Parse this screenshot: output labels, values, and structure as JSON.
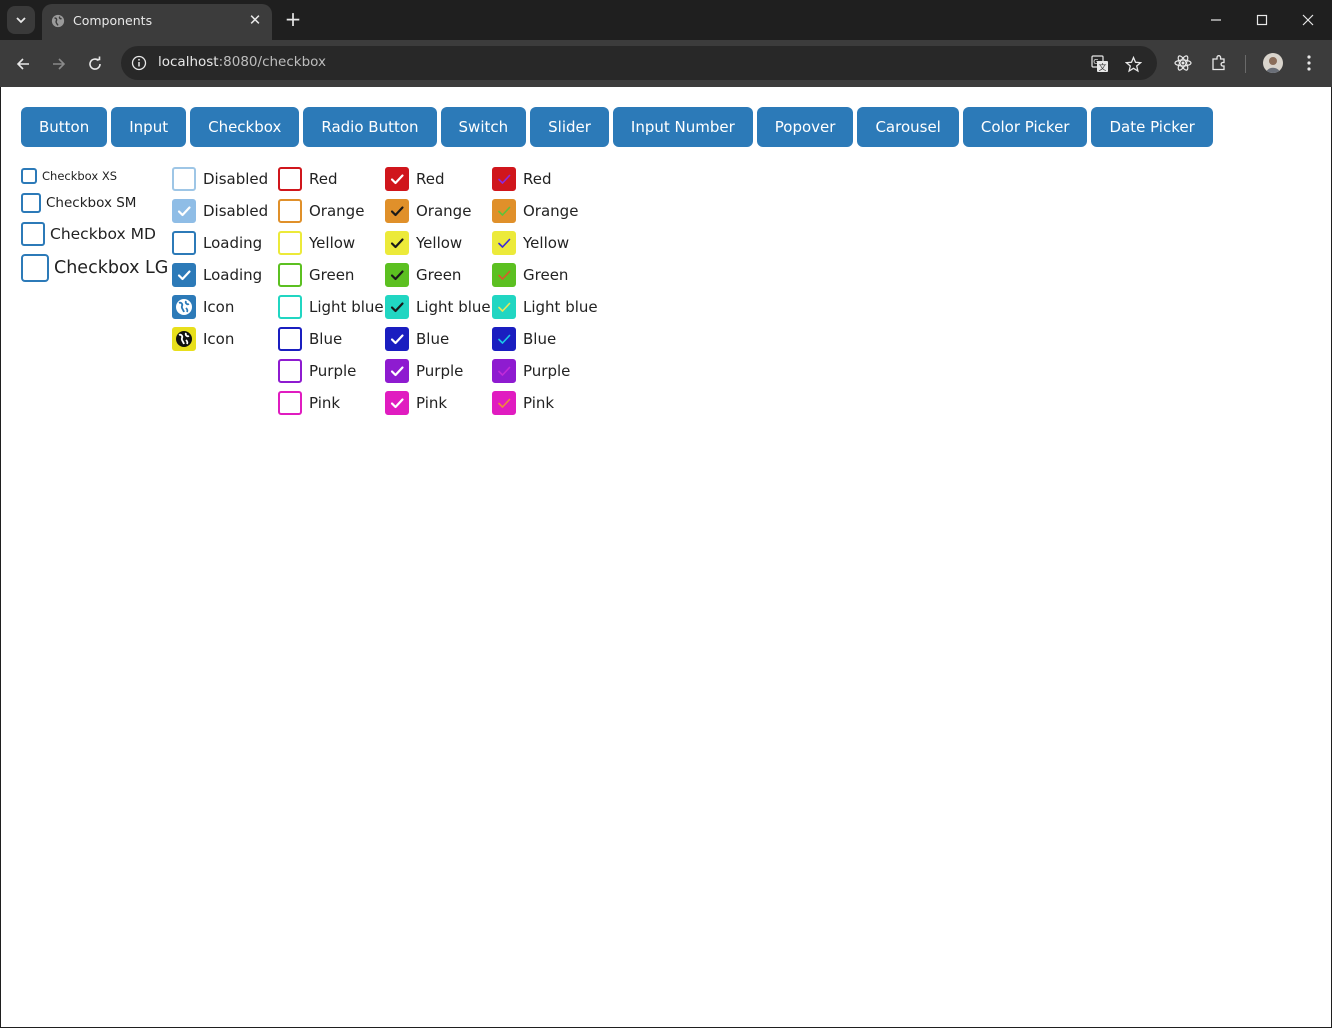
{
  "browser": {
    "tab_title": "Components",
    "url_host": "localhost",
    "url_path": ":8080/checkbox"
  },
  "nav": [
    "Button",
    "Input",
    "Checkbox",
    "Radio Button",
    "Switch",
    "Slider",
    "Input Number",
    "Popover",
    "Carousel",
    "Color Picker",
    "Date Picker"
  ],
  "sizes": [
    "Checkbox XS",
    "Checkbox SM",
    "Checkbox MD",
    "Checkbox LG"
  ],
  "states": [
    {
      "label": "Disabled",
      "state": "disabled-unchecked"
    },
    {
      "label": "Disabled",
      "state": "disabled-checked"
    },
    {
      "label": "Loading",
      "state": "unchecked"
    },
    {
      "label": "Loading",
      "state": "checked"
    },
    {
      "label": "Icon",
      "state": "icon",
      "icon": "globe-icon",
      "bg": "#2c7ab8"
    },
    {
      "label": "Icon",
      "state": "icon",
      "icon": "globe-icon",
      "bg": "#e8df1c"
    }
  ],
  "colors": [
    {
      "label": "Red",
      "color": "#d0161c",
      "mark2": "#8a2be2"
    },
    {
      "label": "Orange",
      "color": "#e0902a",
      "mark2": "#5fc23a"
    },
    {
      "label": "Yellow",
      "color": "#ecea3a",
      "mark2": "#3a2bd8"
    },
    {
      "label": "Green",
      "color": "#5cc021",
      "mark2": "#d85a2b"
    },
    {
      "label": "Light blue",
      "color": "#21d6c2",
      "mark2": "#e8e85a"
    },
    {
      "label": "Blue",
      "color": "#1a1ec0",
      "mark2": "#1ac8e8"
    },
    {
      "label": "Purple",
      "color": "#8e1bd0",
      "mark2": "#c02bd8"
    },
    {
      "label": "Pink",
      "color": "#e01cc0",
      "mark2": "#f08a3a"
    }
  ]
}
